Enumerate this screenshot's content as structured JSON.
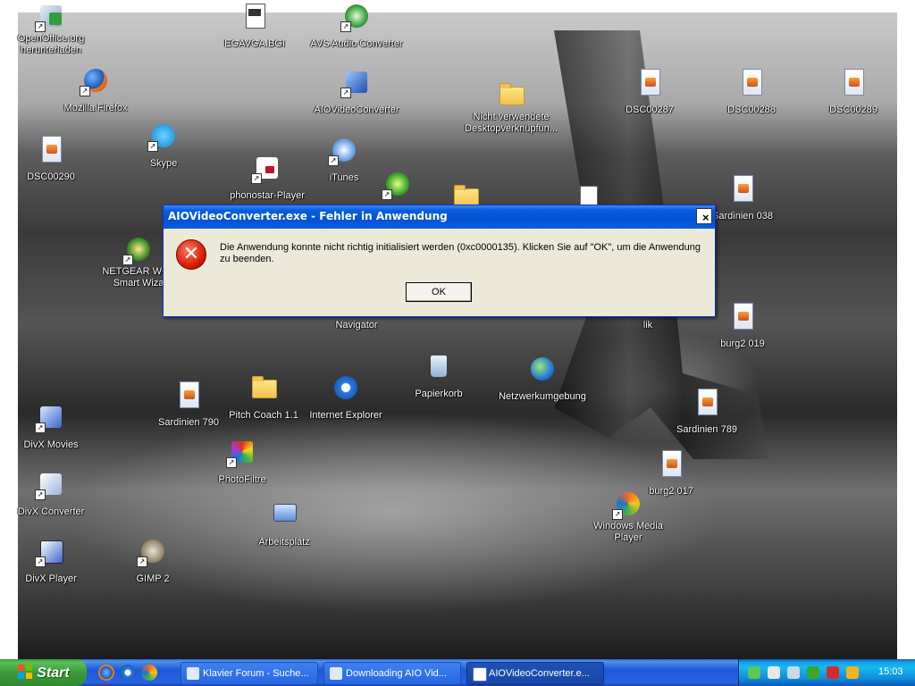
{
  "desktop_icons": [
    {
      "label": "OpenOffice.org herunterladen",
      "icon": "openoffice-download-icon"
    },
    {
      "label": "EGAVGA.BGI",
      "icon": "bgi-file-icon"
    },
    {
      "label": "AVS Audio Converter",
      "icon": "avs-audio-icon"
    },
    {
      "label": "Mozilla Firefox",
      "icon": "firefox-icon"
    },
    {
      "label": "AIOVideoConverter",
      "icon": "aio-video-icon"
    },
    {
      "label": "Nicht verwendete Desktopverknüpfun...",
      "icon": "folder-icon"
    },
    {
      "label": "DSC00287",
      "icon": "image-file-icon"
    },
    {
      "label": "DSC00288",
      "icon": "image-file-icon"
    },
    {
      "label": "DSC00289",
      "icon": "image-file-icon"
    },
    {
      "label": "DSC00290",
      "icon": "image-file-icon"
    },
    {
      "label": "Skype",
      "icon": "skype-icon"
    },
    {
      "label": "iTunes",
      "icon": "itunes-icon"
    },
    {
      "label": "phonostar-Player",
      "icon": "phonostar-icon"
    },
    {
      "label": "Sardinien 038",
      "icon": "image-file-icon"
    },
    {
      "label": "NETGEAR WG1 Smart Wiza",
      "icon": "netgear-icon"
    },
    {
      "label": "Navigator",
      "icon": "navigator-icon"
    },
    {
      "label": "lik",
      "icon": "generic-icon"
    },
    {
      "label": "burg2 019",
      "icon": "image-file-icon"
    },
    {
      "label": "Papierkorb",
      "icon": "recycle-bin-icon"
    },
    {
      "label": "Netzwerkumgebung",
      "icon": "network-icon"
    },
    {
      "label": "Sardinien 790",
      "icon": "image-file-icon"
    },
    {
      "label": "Pitch Coach 1.1",
      "icon": "folder-icon"
    },
    {
      "label": "Internet Explorer",
      "icon": "internet-explorer-icon"
    },
    {
      "label": "Sardinien 789",
      "icon": "image-file-icon"
    },
    {
      "label": "DivX Movies",
      "icon": "divx-icon"
    },
    {
      "label": "PhotoFiltre",
      "icon": "photofiltre-icon"
    },
    {
      "label": "burg2 017",
      "icon": "image-file-icon"
    },
    {
      "label": "DivX Converter",
      "icon": "divx-converter-icon"
    },
    {
      "label": "Windows Media Player",
      "icon": "media-player-icon"
    },
    {
      "label": "Arbeitsplatz",
      "icon": "my-computer-icon"
    },
    {
      "label": "DivX Player",
      "icon": "divx-player-icon"
    },
    {
      "label": "GIMP 2",
      "icon": "gimp-icon"
    }
  ],
  "dialog": {
    "title": "AIOVideoConverter.exe - Fehler in Anwendung",
    "close_label": "×",
    "message": "Die Anwendung konnte nicht richtig initialisiert werden (0xc0000135). Klicken Sie auf \"OK\", um die Anwendung zu beenden.",
    "icon": "error-icon",
    "ok_label": "OK"
  },
  "taskbar": {
    "start_label": "Start",
    "quick_launch": [
      "firefox-icon",
      "internet-explorer-icon",
      "media-player-icon"
    ],
    "tasks": [
      {
        "label": "Klavier Forum - Suche...",
        "active": false
      },
      {
        "label": "Downloading AIO Vid...",
        "active": false
      },
      {
        "label": "AIOVideoConverter.e...",
        "active": true
      }
    ],
    "tray_icons": [
      "network-tray-icon",
      "volume-tray-icon",
      "printer-tray-icon",
      "icq-tray-icon",
      "antivirus-tray-icon",
      "update-tray-icon"
    ],
    "clock": "15:03"
  },
  "colors": {
    "titlebar": "#0451d3",
    "taskbar": "#2157d7",
    "start_green": "#3c9a3c",
    "dialog_bg": "#ece9d8",
    "error_red": "#d81e05"
  }
}
